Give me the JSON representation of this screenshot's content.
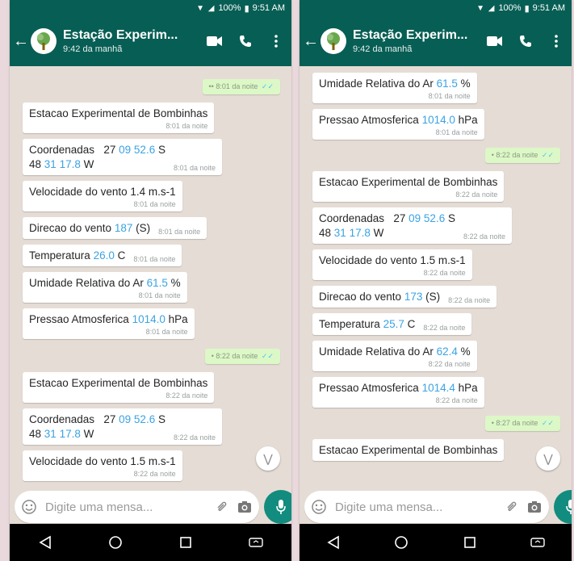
{
  "phones": [
    {
      "status": {
        "battery": "100%",
        "time": "9:51 AM"
      },
      "chat": {
        "title": "Estação Experim...",
        "subtitle": "9:42 da manhã"
      },
      "composer": {
        "placeholder": "Digite uma mensa..."
      },
      "outgoing_top": {
        "time": "8:01 da noite"
      },
      "group1": {
        "station": {
          "text": "Estacao Experimental de Bombinhas",
          "time": "8:01 da noite"
        },
        "coords": {
          "label": "Coordenadas",
          "lat_a": "27",
          "lat_b": "09",
          "lat_c": "52.6",
          "lat_d": "S",
          "lon_a": "48",
          "lon_b": "31",
          "lon_c": "17.8",
          "lon_d": "W",
          "time": "8:01 da noite"
        },
        "wind_speed": {
          "text": "Velocidade do vento 1.4 m.s-1",
          "time": "8:01 da noite"
        },
        "wind_dir": {
          "label": "Direcao do vento",
          "value": "187",
          "suffix": "(S)",
          "time": "8:01 da noite"
        },
        "temp": {
          "label": "Temperatura",
          "value": "26.0",
          "unit": "C",
          "time": "8:01 da noite"
        },
        "humidity": {
          "label": "Umidade Relativa do Ar",
          "value": "61.5",
          "unit": "%",
          "time": "8:01 da noite"
        },
        "pressure": {
          "label": "Pressao Atmosferica",
          "value": "1014.0",
          "unit": "hPa",
          "time": "8:01 da noite"
        }
      },
      "outgoing_mid": {
        "time": "8:22 da noite"
      },
      "group2": {
        "station": {
          "text": "Estacao Experimental de Bombinhas",
          "time": "8:22 da noite"
        },
        "coords": {
          "label": "Coordenadas",
          "lat_a": "27",
          "lat_b": "09",
          "lat_c": "52.6",
          "lat_d": "S",
          "lon_a": "48",
          "lon_b": "31",
          "lon_c": "17.8",
          "lon_d": "W",
          "time": "8:22 da noite"
        },
        "wind_speed": {
          "text": "Velocidade do vento 1.5 m.s-1",
          "time": "8:22 da noite"
        }
      }
    },
    {
      "status": {
        "battery": "100%",
        "time": "9:51 AM"
      },
      "chat": {
        "title": "Estação Experim...",
        "subtitle": "9:42 da manhã"
      },
      "composer": {
        "placeholder": "Digite uma mensa..."
      },
      "group1_tail": {
        "humidity": {
          "label": "Umidade Relativa do Ar",
          "value": "61.5",
          "unit": "%",
          "time": "8:01 da noite"
        },
        "pressure": {
          "label": "Pressao Atmosferica",
          "value": "1014.0",
          "unit": "hPa",
          "time": "8:01 da noite"
        }
      },
      "outgoing_mid": {
        "time": "8:22 da noite"
      },
      "group2": {
        "station": {
          "text": "Estacao Experimental de Bombinhas",
          "time": "8:22 da noite"
        },
        "coords": {
          "label": "Coordenadas",
          "lat_a": "27",
          "lat_b": "09",
          "lat_c": "52.6",
          "lat_d": "S",
          "lon_a": "48",
          "lon_b": "31",
          "lon_c": "17.8",
          "lon_d": "W",
          "time": "8:22 da noite"
        },
        "wind_speed": {
          "text": "Velocidade do vento 1.5 m.s-1",
          "time": "8:22 da noite"
        },
        "wind_dir": {
          "label": "Direcao do vento",
          "value": "173",
          "suffix": "(S)",
          "time": "8:22 da noite"
        },
        "temp": {
          "label": "Temperatura",
          "value": "25.7",
          "unit": "C",
          "time": "8:22 da noite"
        },
        "humidity": {
          "label": "Umidade Relativa do Ar",
          "value": "62.4",
          "unit": "%",
          "time": "8:22 da noite"
        },
        "pressure": {
          "label": "Pressao Atmosferica",
          "value": "1014.4",
          "unit": "hPa",
          "time": "8:22 da noite"
        }
      },
      "outgoing_bottom": {
        "time": "8:27 da noite"
      },
      "group3": {
        "station": {
          "text": "Estacao Experimental de Bombinhas"
        }
      }
    }
  ],
  "colors": {
    "header": "#075e54",
    "highlight": "#3aa3e3",
    "outgoing": "#dcf8c6",
    "fab": "#128c7e",
    "chat_bg": "#e5ddd5"
  },
  "icons": [
    "back-arrow-icon",
    "avatar-tree-icon",
    "video-call-icon",
    "phone-icon",
    "more-vert-icon",
    "emoji-icon",
    "attach-icon",
    "camera-icon",
    "mic-icon",
    "scroll-down-icon",
    "nav-back-icon",
    "nav-home-icon",
    "nav-recents-icon",
    "nav-rotate-icon",
    "double-check-icon"
  ]
}
